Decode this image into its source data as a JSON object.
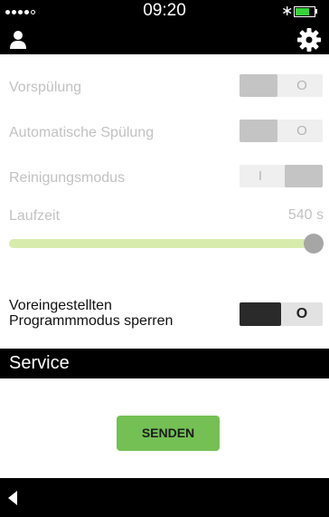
{
  "status_bar": {
    "time": "09:20",
    "bluetooth_symbol": "∗",
    "battery_level": 0.75,
    "battery_color": "#35d43a",
    "signal_dots_filled": 4,
    "signal_dots_total": 5
  },
  "app_bar": {
    "left_icon": "user-icon",
    "right_icon": "gear-icon"
  },
  "settings": {
    "vorspuelung": {
      "label": "Vorspülung",
      "state": "off",
      "symbol": "O"
    },
    "automatische_spuelung": {
      "label": "Automatische Spülung",
      "state": "off",
      "symbol": "O"
    },
    "reinigungsmodus": {
      "label": "Reinigungsmodus",
      "state": "on",
      "symbol": "I"
    },
    "laufzeit": {
      "label": "Laufzeit",
      "value": "540 s",
      "slider_fraction": 1.0
    },
    "programm_sperren": {
      "label_line1": "Voreingestellten",
      "label_line2": "Programmmodus sperren",
      "state": "off",
      "symbol": "O"
    }
  },
  "service": {
    "title": "Service",
    "send_label": "SENDEN",
    "send_color": "#74c054"
  },
  "bottom_bar": {
    "back_icon": "back-arrow-icon"
  }
}
